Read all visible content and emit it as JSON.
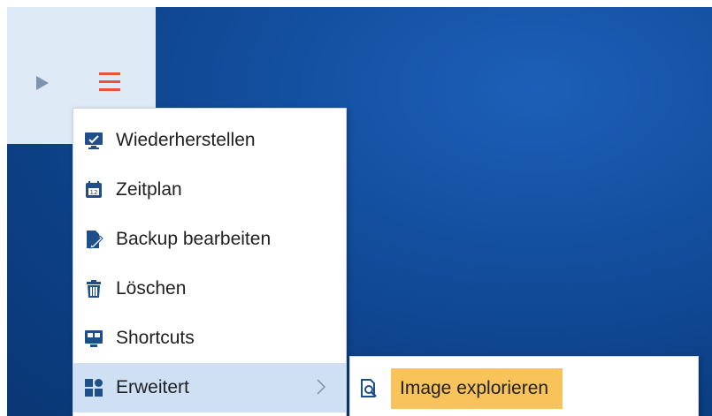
{
  "toolbar": {
    "play_icon": "play-arrow-icon",
    "menu_icon": "hamburger-menu-icon",
    "menu_icon_color": "#e8533a"
  },
  "context_menu": {
    "items": [
      {
        "label": "Wiederherstellen",
        "icon": "restore-monitor-icon"
      },
      {
        "label": "Zeitplan",
        "icon": "calendar-icon"
      },
      {
        "label": "Backup bearbeiten",
        "icon": "edit-document-icon"
      },
      {
        "label": "Löschen",
        "icon": "trash-icon"
      },
      {
        "label": "Shortcuts",
        "icon": "shortcut-icon"
      },
      {
        "label": "Erweitert",
        "icon": "grid-tiles-icon",
        "has_submenu": true,
        "active": true
      }
    ]
  },
  "submenu": {
    "items": [
      {
        "label": "Image explorieren",
        "icon": "image-explore-icon",
        "highlighted": true
      }
    ],
    "highlight_color": "#f8c35a"
  },
  "colors": {
    "accent_icon": "#1f4f8a",
    "desktop_blue": "#134f9f",
    "panel_bg": "#dfeaf7",
    "active_row": "#cfe0f5"
  }
}
